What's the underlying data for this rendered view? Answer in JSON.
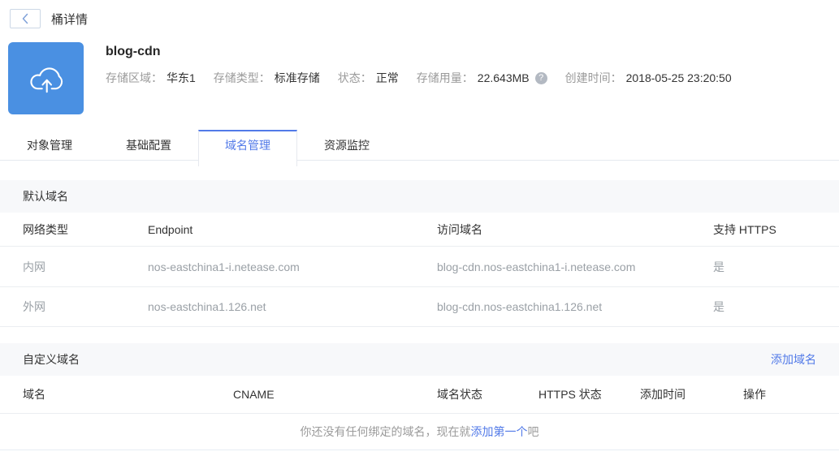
{
  "colors": {
    "accent": "#527ae8",
    "bucket_icon_blue": "#4a90e2"
  },
  "page": {
    "back_title": "桶详情"
  },
  "header": {
    "title": "blog-cdn",
    "info": [
      {
        "label": "存储区域：",
        "value": "华东1"
      },
      {
        "label": "存储类型：",
        "value": "标准存储"
      },
      {
        "label": "状态：",
        "value": "正常"
      },
      {
        "label": "存储用量：",
        "value": "22.643MB"
      },
      {
        "label": "创建时间：",
        "value": "2018-05-25 23:20:50"
      }
    ]
  },
  "tabs": [
    {
      "label": "对象管理",
      "active": false
    },
    {
      "label": "基础配置",
      "active": false
    },
    {
      "label": "域名管理",
      "active": true
    },
    {
      "label": "资源监控",
      "active": false
    }
  ],
  "default_domains": {
    "section_title": "默认域名",
    "columns": [
      "网络类型",
      "Endpoint",
      "访问域名",
      "支持 HTTPS"
    ],
    "rows": [
      {
        "network": "内网",
        "endpoint": "nos-eastchina1-i.netease.com",
        "domain": "blog-cdn.nos-eastchina1-i.netease.com",
        "https": "是"
      },
      {
        "network": "外网",
        "endpoint": "nos-eastchina1.126.net",
        "domain": "blog-cdn.nos-eastchina1.126.net",
        "https": "是"
      }
    ]
  },
  "custom_domains": {
    "section_title": "自定义域名",
    "add_button_label": "添加域名",
    "columns": [
      "域名",
      "CNAME",
      "域名状态",
      "HTTPS 状态",
      "添加时间",
      "操作"
    ],
    "empty_state": {
      "prefix": "你还没有任何绑定的域名，现在就",
      "link": "添加第一个",
      "suffix": "吧"
    }
  }
}
